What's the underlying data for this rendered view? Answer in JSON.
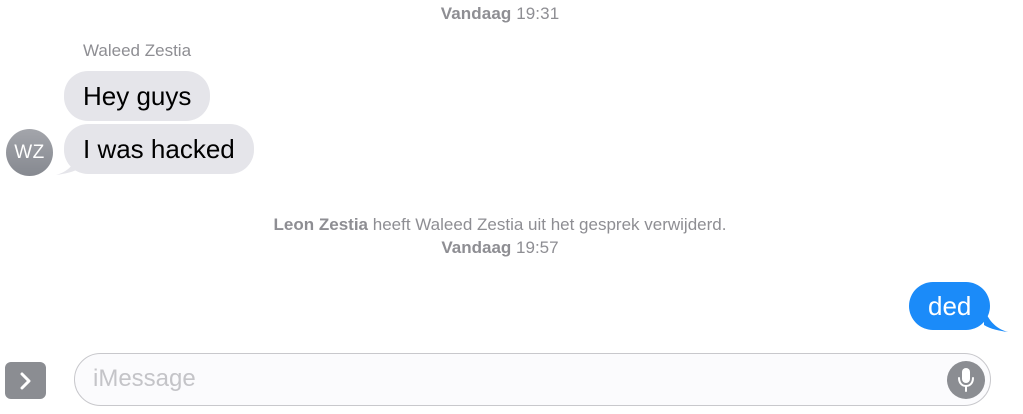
{
  "conversation": {
    "timestamp_1": {
      "day": "Vandaag",
      "time": "19:31"
    },
    "sender_name": "Waleed Zestia",
    "avatar_initials": "WZ",
    "incoming_messages": [
      {
        "text": "Hey guys"
      },
      {
        "text": "I was hacked"
      }
    ],
    "system_note": {
      "actor": "Leon Zestia",
      "text": "heeft Waleed Zestia uit het gesprek verwijderd.",
      "timestamp": {
        "day": "Vandaag",
        "time": "19:57"
      }
    },
    "outgoing_messages": [
      {
        "text": "ded"
      }
    ]
  },
  "composer": {
    "placeholder": "iMessage",
    "value": "",
    "apps_icon": "chevron-right-icon",
    "mic_icon": "microphone-icon"
  },
  "colors": {
    "incoming_bubble": "#e5e5ea",
    "outgoing_bubble": "#1b8bf9",
    "meta_text": "#8e8e93",
    "icon_gray": "#8b8d92"
  }
}
